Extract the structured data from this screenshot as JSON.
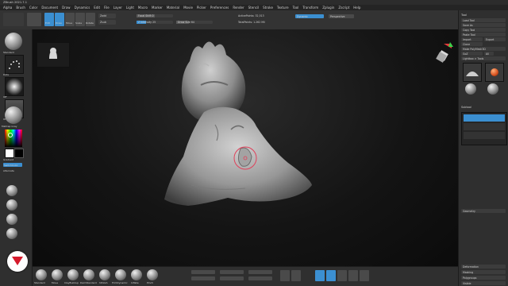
{
  "window": {
    "title": "ZBrush 2021.7.1"
  },
  "menu": {
    "items": [
      "Alpha",
      "Brush",
      "Color",
      "Document",
      "Draw",
      "Dynamics",
      "Edit",
      "File",
      "Layer",
      "Light",
      "Macro",
      "Marker",
      "Material",
      "Movie",
      "Picker",
      "Preferences",
      "Render",
      "Stencil",
      "Stroke",
      "Texture",
      "Tool",
      "Transform",
      "Zplugin",
      "Zscript",
      "Help"
    ]
  },
  "shelf": {
    "edit_label": "Edit",
    "draw_label": "Draw",
    "move_label": "Move",
    "scale_label": "Scale",
    "rotate_label": "Rotate",
    "zadd_label": "Zadd",
    "zsub_label": "Zsub",
    "focal_label": "Focal Shift 0",
    "intensity_label": "Z Intensity 25",
    "drawsize_label": "Draw Size 64",
    "active_points_label": "ActivePoints: 32,513",
    "total_points_label": "TotalPoints: 1.262 Mil",
    "dynamic_label": "Dynamic",
    "perspective_label": "Perspective"
  },
  "left": {
    "brush_label": "Standard",
    "stroke_label": "Dots",
    "alpha_label": "Off",
    "texture_label": "Off",
    "material_label": "MatCap Gray",
    "gradient_label": "Gradient",
    "switch_label": "SwitchColor",
    "alternate_label": "Alternate"
  },
  "right": {
    "title": "Tool",
    "load_label": "Load Tool",
    "save_label": "Save As",
    "copy_label": "Copy Tool",
    "paste_label": "Paste Tool",
    "import_label": "Import",
    "export_label": "Export",
    "clone_label": "Clone",
    "make_label": "Make PolyMesh3D",
    "goz_label": "GoZ",
    "all_label": "All",
    "visible_label": "Visible",
    "lightbox_label": "Lightbox > Tools",
    "subtool_label": "Subtool",
    "geometry_label": "Geometry",
    "deformation_label": "Deformation",
    "masking_label": "Masking",
    "polygroups_label": "Polygroups"
  },
  "bottom": {
    "brushes": [
      "Standard",
      "Move",
      "ClayBuildup",
      "DamStandard",
      "hPolish",
      "TrimDynamic",
      "Inflate",
      "Pinch"
    ]
  },
  "colors": {
    "accent": "#3b8fd1",
    "mesh": "#9a9a9a",
    "viewport_bg": "#121212",
    "cursor": "#e0415a",
    "logo_red": "#d51a2c"
  }
}
